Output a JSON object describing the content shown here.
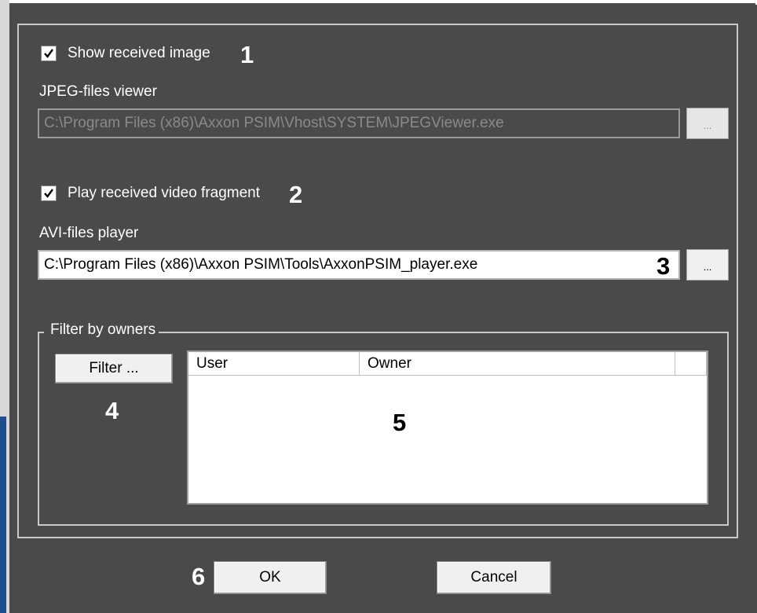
{
  "show_image": {
    "label": "Show received image",
    "checked": true,
    "callout": "1"
  },
  "jpeg_viewer": {
    "label": "JPEG-files viewer",
    "value": "C:\\Program Files (x86)\\Axxon PSIM\\Vhost\\SYSTEM\\JPEGViewer.exe",
    "browse_label": "...",
    "enabled": false
  },
  "play_video": {
    "label": "Play received video fragment",
    "checked": true,
    "callout": "2"
  },
  "avi_player": {
    "label": "AVI-files player",
    "value": "C:\\Program Files (x86)\\Axxon PSIM\\Tools\\AxxonPSIM_player.exe",
    "browse_label": "...",
    "callout": "3",
    "enabled": true
  },
  "filter_group": {
    "title": "Filter by owners",
    "filter_button": "Filter ...",
    "filter_callout": "4",
    "list_callout": "5",
    "columns": [
      "User",
      "Owner"
    ]
  },
  "footer": {
    "ok_label": "OK",
    "cancel_label": "Cancel",
    "ok_callout": "6"
  },
  "colors": {
    "dialog_bg": "#4a4a4a",
    "frame": "#c8c8c8",
    "text": "#ffffff"
  }
}
